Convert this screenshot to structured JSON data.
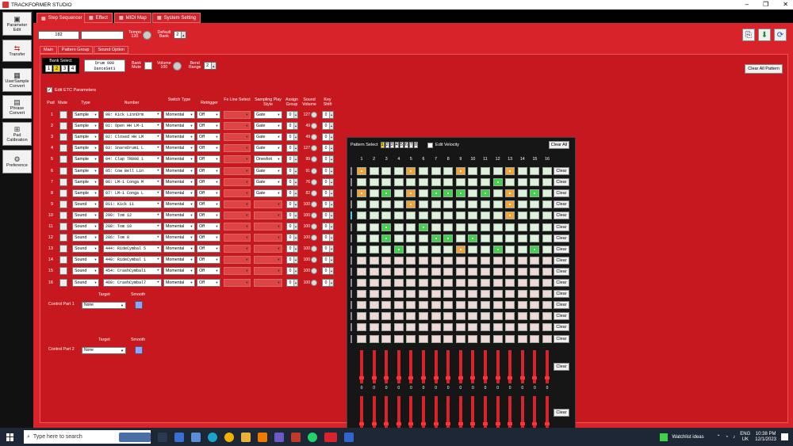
{
  "app": {
    "title": "TRACKFORMER STUDIO"
  },
  "sidebar": [
    "Parameter Edit",
    "Transfer",
    "UserSample Convert",
    "Phrase Convert",
    "Pad Calibration",
    "Preference"
  ],
  "toptabs": [
    "Step Sequencer",
    "Effect",
    "MIDI Map",
    "System Setting"
  ],
  "controls": {
    "bpm": "182",
    "tempo_label": "Tempo",
    "tempo_value": "120",
    "default_bank_label": "Default Bank",
    "default_bank_value": "2"
  },
  "subtabs": [
    "Main",
    "Pattern Group",
    "Sound Option"
  ],
  "bank": {
    "label": "Bank Select",
    "numbers": [
      "1",
      "2",
      "3",
      "4"
    ],
    "selected": "2",
    "drum_line1": "Drum 000",
    "drum_line2": "DanceSet1",
    "bank_mute": "Bank Mute",
    "volume_label": "Volume",
    "volume_value": "100",
    "bend_label": "Bend Range",
    "bend_value": "2",
    "clear_all_pattern": "Clear All Pattern"
  },
  "etc": {
    "label": "Edit ETC Parameters",
    "checkmark": "✓"
  },
  "headers": {
    "pad": "Pad",
    "mute": "Mute",
    "type": "Type",
    "number": "Number",
    "switch": "Switch Type",
    "retrig": "Retrigger",
    "fxline": "Fx Line Select",
    "sampling": "Sampling Play Style",
    "assign": "Assign Group",
    "sound": "Sound Volume",
    "key": "Key Shift"
  },
  "rows": [
    {
      "pad": "1",
      "type": "Sample",
      "number": "00: Kick LinnDrm",
      "switch": "Momental",
      "retrig": "Off",
      "fx": "",
      "play": "Gate",
      "assign": "0",
      "vol": "127",
      "key": "0"
    },
    {
      "pad": "2",
      "type": "Sample",
      "number": "01: Open HH LM-1",
      "switch": "Momental",
      "retrig": "Off",
      "fx": "",
      "play": "Gate",
      "assign": "0",
      "vol": "49",
      "key": "0"
    },
    {
      "pad": "3",
      "type": "Sample",
      "number": "02: Closed HH LM",
      "switch": "Momental",
      "retrig": "Off",
      "fx": "",
      "play": "Gate",
      "assign": "0",
      "vol": "49",
      "key": "0"
    },
    {
      "pad": "4",
      "type": "Sample",
      "number": "03: SnareDrum1 L",
      "switch": "Momental",
      "retrig": "Off",
      "fx": "",
      "play": "Gate",
      "assign": "0",
      "vol": "127",
      "key": "0"
    },
    {
      "pad": "5",
      "type": "Sample",
      "number": "04: Clap TR808 1",
      "switch": "Momental",
      "retrig": "Off",
      "fx": "",
      "play": "Oneshot",
      "assign": "0",
      "vol": "99",
      "key": "0"
    },
    {
      "pad": "6",
      "type": "Sample",
      "number": "05: Cow Bell Lin",
      "switch": "Momental",
      "retrig": "Off",
      "fx": "",
      "play": "Gate",
      "assign": "0",
      "vol": "91",
      "key": "0"
    },
    {
      "pad": "7",
      "type": "Sample",
      "number": "06: LM-1 Conga M",
      "switch": "Momental",
      "retrig": "Off",
      "fx": "",
      "play": "Gate",
      "assign": "0",
      "vol": "76",
      "key": "0"
    },
    {
      "pad": "8",
      "type": "Sample",
      "number": "07: LM-1 Conga L",
      "switch": "Momental",
      "retrig": "Off",
      "fx": "",
      "play": "Gate",
      "assign": "0",
      "vol": "82",
      "key": "0"
    },
    {
      "pad": "9",
      "type": "Sound",
      "number": "811: Kick 11",
      "switch": "Momental",
      "retrig": "Off",
      "fx": "",
      "play": "",
      "assign": "0",
      "vol": "100",
      "key": "0"
    },
    {
      "pad": "10",
      "type": "Sound",
      "number": "290: Tom 12",
      "switch": "Momental",
      "retrig": "Off",
      "fx": "",
      "play": "",
      "assign": "0",
      "vol": "100",
      "key": "0"
    },
    {
      "pad": "11",
      "type": "Sound",
      "number": "288: Tom 10",
      "switch": "Momental",
      "retrig": "Off",
      "fx": "",
      "play": "",
      "assign": "0",
      "vol": "100",
      "key": "0"
    },
    {
      "pad": "12",
      "type": "Sound",
      "number": "286: Tom 8",
      "switch": "Momental",
      "retrig": "Off",
      "fx": "",
      "play": "",
      "assign": "0",
      "vol": "100",
      "key": "0"
    },
    {
      "pad": "13",
      "type": "Sound",
      "number": "444: RideCymbal 5",
      "switch": "Momental",
      "retrig": "Off",
      "fx": "",
      "play": "",
      "assign": "0",
      "vol": "100",
      "key": "0"
    },
    {
      "pad": "14",
      "type": "Sound",
      "number": "440: RideCymbal 1",
      "switch": "Momental",
      "retrig": "Off",
      "fx": "",
      "play": "",
      "assign": "0",
      "vol": "100",
      "key": "0"
    },
    {
      "pad": "15",
      "type": "Sound",
      "number": "454: CrashCymbal1",
      "switch": "Momental",
      "retrig": "Off",
      "fx": "",
      "play": "",
      "assign": "0",
      "vol": "100",
      "key": "0"
    },
    {
      "pad": "16",
      "type": "Sound",
      "number": "460: CrashCymbal7",
      "switch": "Momental",
      "retrig": "Off",
      "fx": "",
      "play": "",
      "assign": "0",
      "vol": "100",
      "key": "0"
    }
  ],
  "control_parts": [
    {
      "label": "Control Part 1",
      "target_label": "Target",
      "target": "None",
      "smooth": "Smooth"
    },
    {
      "label": "Control Part 2",
      "target_label": "Target",
      "target": "None",
      "smooth": "Smooth"
    }
  ],
  "pattern": {
    "label": "Pattern Select",
    "numbers": [
      "1",
      "2",
      "3",
      "4",
      "5",
      "6",
      "7",
      "8"
    ],
    "selected": "1",
    "edit_velocity": "Edit Velocity",
    "clear_all": "Clear All",
    "clear": "Clear",
    "columns": [
      "1",
      "2",
      "3",
      "4",
      "5",
      "6",
      "7",
      "8",
      "9",
      "10",
      "11",
      "12",
      "13",
      "14",
      "15",
      "16"
    ],
    "grid": [
      "o...o...o...o...",
      "...........g....",
      "o.g.o.ggg.g.o.g.",
      "....o.......o...",
      "............o...",
      "..g..g..........",
      "..g...gg.g......",
      "...g....o..g..g.",
      "pppppppppppppppp",
      "pppppppppppppppp",
      "pppppppppppppppp",
      "pppppppppppppppp",
      "pppppppppppppppp",
      "pppppppppppppppp",
      "pppppppppppppppp",
      "pppppppppppppppp"
    ],
    "slider_values": [
      "0",
      "0",
      "0",
      "0",
      "0",
      "0",
      "0",
      "0",
      "0",
      "0",
      "0",
      "0",
      "0",
      "0",
      "0",
      "0"
    ]
  },
  "taskbar": {
    "search": "Type here to search",
    "watchlist": "Watchlist ideas",
    "lang1": "ENG",
    "lang2": "UK",
    "time": "10:38 PM",
    "date": "12/1/2023"
  },
  "colors": {
    "panel": "#d8232a",
    "orange": "#f3a23a",
    "green": "#3fd34a"
  }
}
